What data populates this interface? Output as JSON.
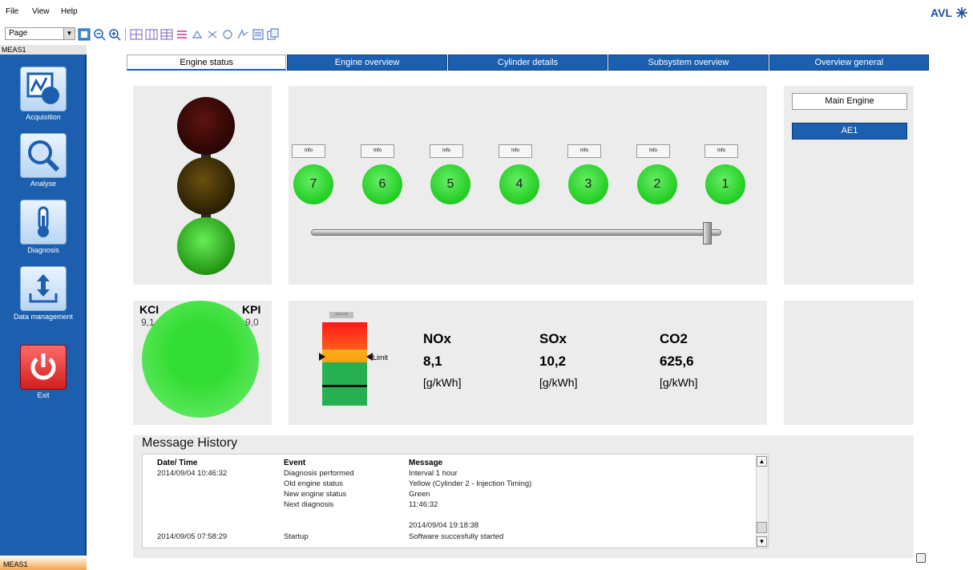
{
  "menu": {
    "file": "File",
    "view": "View",
    "help": "Help"
  },
  "toolbar": {
    "page_select": "Page"
  },
  "brand": {
    "name": "AVL"
  },
  "sidebar": {
    "header": "MEAS1",
    "items": [
      {
        "label": "Acquisition"
      },
      {
        "label": "Analyse"
      },
      {
        "label": "Diagnosis"
      },
      {
        "label": "Data management"
      },
      {
        "label": "Exit"
      }
    ],
    "footer": "MEAS1",
    "footer_dots": "............"
  },
  "tabs": [
    {
      "label": "Engine status"
    },
    {
      "label": "Engine overview"
    },
    {
      "label": "Cylinder details"
    },
    {
      "label": "Subsystem overview"
    },
    {
      "label": "Overview general"
    }
  ],
  "cylinders": [
    {
      "info": "Info",
      "number": "7",
      "status": "green"
    },
    {
      "info": "Info",
      "number": "6",
      "status": "green"
    },
    {
      "info": "Info",
      "number": "5",
      "status": "green"
    },
    {
      "info": "Info",
      "number": "4",
      "status": "green"
    },
    {
      "info": "Info",
      "number": "3",
      "status": "green"
    },
    {
      "info": "Info",
      "number": "2",
      "status": "green"
    },
    {
      "info": "Info",
      "number": "1",
      "status": "green"
    }
  ],
  "engines": {
    "main": "Main Engine",
    "ae1": "AE1"
  },
  "kci": {
    "label": "KCI",
    "value": "9,1"
  },
  "kpi": {
    "label": "KPI",
    "value": "9,0"
  },
  "emissions": {
    "tag": "ECA ON",
    "limit_label": "Limit",
    "items": [
      {
        "name": "NOx",
        "value": "8,1",
        "unit": "[g/kWh]"
      },
      {
        "name": "SOx",
        "value": "10,2",
        "unit": "[g/kWh]"
      },
      {
        "name": "CO2",
        "value": "625,6",
        "unit": "[g/kWh]"
      }
    ]
  },
  "message_history": {
    "title": "Message History",
    "headers": {
      "datetime": "Date/ Time",
      "event": "Event",
      "message": "Message"
    },
    "rows": [
      {
        "datetime": "2014/09/04 10:46:32",
        "event": "Diagnosis performed",
        "message": "Interval 1 hour"
      },
      {
        "datetime": "",
        "event": "Old engine status",
        "message": "Yellow (Cylinder 2 - Injection Timing)"
      },
      {
        "datetime": "",
        "event": "New engine status",
        "message": "Green"
      },
      {
        "datetime": "",
        "event": "Next diagnosis",
        "message": "11:46:32"
      },
      {
        "datetime": "",
        "event": "",
        "message": "2014/09/04 19:18:38"
      },
      {
        "datetime": "2014/09/05 07:58:29",
        "event": "Startup",
        "message": "Software succesfully started"
      }
    ]
  },
  "colors": {
    "accent_blue": "#1b5fae",
    "status_green": "#22cc22",
    "panel_gray": "#ececec"
  }
}
